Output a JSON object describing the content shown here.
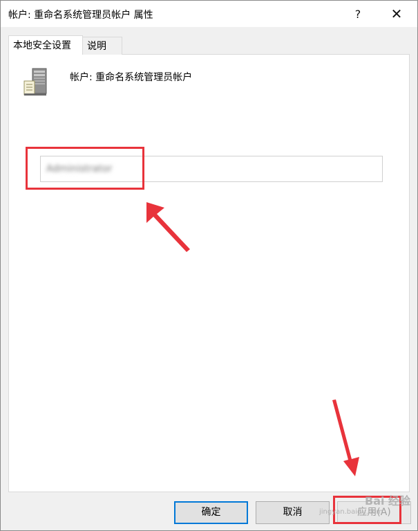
{
  "window": {
    "title": "帐户: 重命名系统管理员帐户 属性",
    "help_label": "?",
    "close_label": "✕"
  },
  "tabs": [
    {
      "label": "本地安全设置",
      "active": true
    },
    {
      "label": "说明",
      "active": false
    }
  ],
  "policy": {
    "icon": "server-icon",
    "heading": "帐户: 重命名系统管理员帐户",
    "input_value": "Administrator"
  },
  "buttons": {
    "ok_label": "确定",
    "cancel_label": "取消",
    "apply_label": "应用(A)"
  },
  "annotations": {
    "color": "#e8333b"
  },
  "watermark": {
    "line1": "Bai 经验",
    "line2": "jingyan.baidu.com"
  }
}
